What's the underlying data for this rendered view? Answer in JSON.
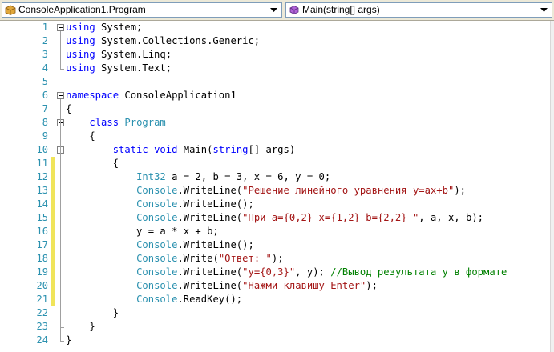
{
  "nav": {
    "class_selector": "ConsoleApplication1.Program",
    "member_selector": "Main(string[] args)"
  },
  "lines": [
    {
      "n": "1",
      "tokens": [
        {
          "t": "kw",
          "s": "using"
        },
        {
          "t": "p",
          "s": " System;"
        }
      ]
    },
    {
      "n": "2",
      "tokens": [
        {
          "t": "kw",
          "s": "using"
        },
        {
          "t": "p",
          "s": " System.Collections.Generic;"
        }
      ]
    },
    {
      "n": "3",
      "tokens": [
        {
          "t": "kw",
          "s": "using"
        },
        {
          "t": "p",
          "s": " System.Linq;"
        }
      ]
    },
    {
      "n": "4",
      "tokens": [
        {
          "t": "kw",
          "s": "using"
        },
        {
          "t": "p",
          "s": " System.Text;"
        }
      ]
    },
    {
      "n": "5",
      "tokens": []
    },
    {
      "n": "6",
      "tokens": [
        {
          "t": "kw",
          "s": "namespace"
        },
        {
          "t": "p",
          "s": " ConsoleApplication1"
        }
      ]
    },
    {
      "n": "7",
      "tokens": [
        {
          "t": "p",
          "s": "{"
        }
      ]
    },
    {
      "n": "8",
      "tokens": [
        {
          "t": "p",
          "s": "    "
        },
        {
          "t": "kw",
          "s": "class"
        },
        {
          "t": "p",
          "s": " "
        },
        {
          "t": "ty",
          "s": "Program"
        }
      ]
    },
    {
      "n": "9",
      "tokens": [
        {
          "t": "p",
          "s": "    {"
        }
      ]
    },
    {
      "n": "10",
      "tokens": [
        {
          "t": "p",
          "s": "        "
        },
        {
          "t": "kw",
          "s": "static"
        },
        {
          "t": "p",
          "s": " "
        },
        {
          "t": "kw",
          "s": "void"
        },
        {
          "t": "p",
          "s": " Main("
        },
        {
          "t": "kw",
          "s": "string"
        },
        {
          "t": "p",
          "s": "[] args)"
        }
      ]
    },
    {
      "n": "11",
      "tokens": [
        {
          "t": "p",
          "s": "        {"
        }
      ]
    },
    {
      "n": "12",
      "tokens": [
        {
          "t": "p",
          "s": "            "
        },
        {
          "t": "ty",
          "s": "Int32"
        },
        {
          "t": "p",
          "s": " a = 2, b = 3, x = 6, y = 0;"
        }
      ]
    },
    {
      "n": "13",
      "tokens": [
        {
          "t": "p",
          "s": "            "
        },
        {
          "t": "ty",
          "s": "Console"
        },
        {
          "t": "p",
          "s": ".WriteLine("
        },
        {
          "t": "str",
          "s": "\"Решение линейного уравнения y=ax+b\""
        },
        {
          "t": "p",
          "s": ");"
        }
      ]
    },
    {
      "n": "14",
      "tokens": [
        {
          "t": "p",
          "s": "            "
        },
        {
          "t": "ty",
          "s": "Console"
        },
        {
          "t": "p",
          "s": ".WriteLine();"
        }
      ]
    },
    {
      "n": "15",
      "tokens": [
        {
          "t": "p",
          "s": "            "
        },
        {
          "t": "ty",
          "s": "Console"
        },
        {
          "t": "p",
          "s": ".WriteLine("
        },
        {
          "t": "str",
          "s": "\"При a={0,2} x={1,2} b={2,2} \""
        },
        {
          "t": "p",
          "s": ", a, x, b);"
        }
      ]
    },
    {
      "n": "16",
      "tokens": [
        {
          "t": "p",
          "s": "            y = a * x + b;"
        }
      ]
    },
    {
      "n": "17",
      "tokens": [
        {
          "t": "p",
          "s": "            "
        },
        {
          "t": "ty",
          "s": "Console"
        },
        {
          "t": "p",
          "s": ".WriteLine();"
        }
      ]
    },
    {
      "n": "18",
      "tokens": [
        {
          "t": "p",
          "s": "            "
        },
        {
          "t": "ty",
          "s": "Console"
        },
        {
          "t": "p",
          "s": ".Write("
        },
        {
          "t": "str",
          "s": "\"Ответ: \""
        },
        {
          "t": "p",
          "s": ");"
        }
      ]
    },
    {
      "n": "19",
      "tokens": [
        {
          "t": "p",
          "s": "            "
        },
        {
          "t": "ty",
          "s": "Console"
        },
        {
          "t": "p",
          "s": ".WriteLine("
        },
        {
          "t": "str",
          "s": "\"y={0,3}\""
        },
        {
          "t": "p",
          "s": ", y); "
        },
        {
          "t": "cm",
          "s": "//Вывод результата y в формате"
        }
      ]
    },
    {
      "n": "20",
      "tokens": [
        {
          "t": "p",
          "s": "            "
        },
        {
          "t": "ty",
          "s": "Console"
        },
        {
          "t": "p",
          "s": ".WriteLine("
        },
        {
          "t": "str",
          "s": "\"Нажми клавишу Enter\""
        },
        {
          "t": "p",
          "s": ");"
        }
      ]
    },
    {
      "n": "21",
      "tokens": [
        {
          "t": "p",
          "s": "            "
        },
        {
          "t": "ty",
          "s": "Console"
        },
        {
          "t": "p",
          "s": ".ReadKey();"
        }
      ]
    },
    {
      "n": "22",
      "tokens": [
        {
          "t": "p",
          "s": "        }"
        }
      ]
    },
    {
      "n": "23",
      "tokens": [
        {
          "t": "p",
          "s": "    }"
        }
      ]
    },
    {
      "n": "24",
      "tokens": [
        {
          "t": "p",
          "s": "}"
        }
      ]
    }
  ],
  "changed_lines": [
    "11",
    "12",
    "13",
    "14",
    "15",
    "16",
    "17",
    "18",
    "19",
    "20",
    "21"
  ],
  "fold_lines": [
    "1",
    "6",
    "8",
    "10"
  ],
  "colors": {
    "keyword": "#0000ff",
    "type": "#2b91af",
    "string": "#a31515",
    "comment": "#008000",
    "line_number": "#2b91af",
    "change_marker": "#f0e45a"
  }
}
